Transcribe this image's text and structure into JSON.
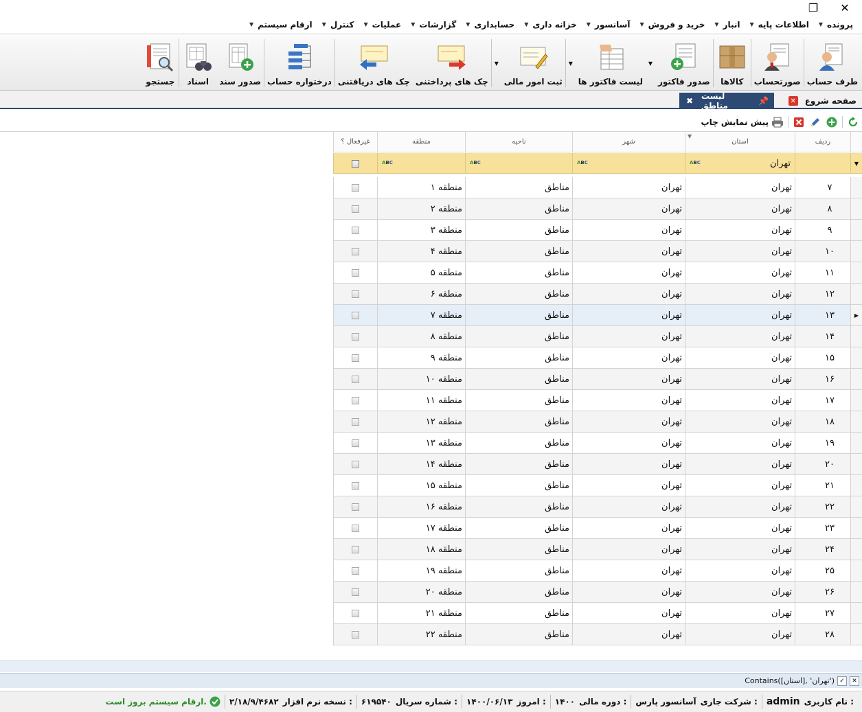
{
  "window": {
    "restore_glyph": "❐",
    "close_glyph": "✕"
  },
  "menu": [
    {
      "label": "پرونده"
    },
    {
      "label": "اطلاعات پایه"
    },
    {
      "label": "انبار"
    },
    {
      "label": "خرید و فروش"
    },
    {
      "label": "آسانسور"
    },
    {
      "label": "خزانه داری"
    },
    {
      "label": "حسابداری"
    },
    {
      "label": "گزارشات"
    },
    {
      "label": "عملیات"
    },
    {
      "label": "کنترل"
    },
    {
      "label": "ارقام سیستم"
    }
  ],
  "toolbar": {
    "party": "طرف حساب",
    "statement": "صورتحساب",
    "goods": "کالاها",
    "issue_invoice": "صدور فاکتور",
    "invoice_list": "لیست فاکتور ها",
    "financial": "ثبت امور مالی",
    "cheques_paid": "چک های پرداختنی",
    "cheques_received": "چک های دریافتنی",
    "account_tree": "درختواره حساب",
    "issue_doc": "صدور سند",
    "docs": "اسناد",
    "search": "جستجو"
  },
  "tabs": {
    "start": "صفحه شروع",
    "regions": "لیست مناطق"
  },
  "grid_tools": {
    "print_preview": "پیش نمایش چاپ"
  },
  "columns": {
    "row": "ردیف",
    "province": "استان",
    "city": "شهر",
    "district": "ناحیه",
    "region": "منطقه",
    "inactive": "غیرفعال ؟"
  },
  "filter": {
    "province": "تهران"
  },
  "rows": [
    {
      "n": "۷",
      "province": "تهران",
      "city": "تهران",
      "district": "مناطق",
      "region": "منطقه ۱"
    },
    {
      "n": "۸",
      "province": "تهران",
      "city": "تهران",
      "district": "مناطق",
      "region": "منطقه ۲"
    },
    {
      "n": "۹",
      "province": "تهران",
      "city": "تهران",
      "district": "مناطق",
      "region": "منطقه ۳"
    },
    {
      "n": "۱۰",
      "province": "تهران",
      "city": "تهران",
      "district": "مناطق",
      "region": "منطقه ۴"
    },
    {
      "n": "۱۱",
      "province": "تهران",
      "city": "تهران",
      "district": "مناطق",
      "region": "منطقه ۵"
    },
    {
      "n": "۱۲",
      "province": "تهران",
      "city": "تهران",
      "district": "مناطق",
      "region": "منطقه ۶"
    },
    {
      "n": "۱۳",
      "province": "تهران",
      "city": "تهران",
      "district": "مناطق",
      "region": "منطقه ۷"
    },
    {
      "n": "۱۴",
      "province": "تهران",
      "city": "تهران",
      "district": "مناطق",
      "region": "منطقه ۸"
    },
    {
      "n": "۱۵",
      "province": "تهران",
      "city": "تهران",
      "district": "مناطق",
      "region": "منطقه ۹"
    },
    {
      "n": "۱۶",
      "province": "تهران",
      "city": "تهران",
      "district": "مناطق",
      "region": "منطقه ۱۰"
    },
    {
      "n": "۱۷",
      "province": "تهران",
      "city": "تهران",
      "district": "مناطق",
      "region": "منطقه ۱۱"
    },
    {
      "n": "۱۸",
      "province": "تهران",
      "city": "تهران",
      "district": "مناطق",
      "region": "منطقه ۱۲"
    },
    {
      "n": "۱۹",
      "province": "تهران",
      "city": "تهران",
      "district": "مناطق",
      "region": "منطقه ۱۳"
    },
    {
      "n": "۲۰",
      "province": "تهران",
      "city": "تهران",
      "district": "مناطق",
      "region": "منطقه ۱۴"
    },
    {
      "n": "۲۱",
      "province": "تهران",
      "city": "تهران",
      "district": "مناطق",
      "region": "منطقه ۱۵"
    },
    {
      "n": "۲۲",
      "province": "تهران",
      "city": "تهران",
      "district": "مناطق",
      "region": "منطقه ۱۶"
    },
    {
      "n": "۲۳",
      "province": "تهران",
      "city": "تهران",
      "district": "مناطق",
      "region": "منطقه ۱۷"
    },
    {
      "n": "۲۴",
      "province": "تهران",
      "city": "تهران",
      "district": "مناطق",
      "region": "منطقه ۱۸"
    },
    {
      "n": "۲۵",
      "province": "تهران",
      "city": "تهران",
      "district": "مناطق",
      "region": "منطقه ۱۹"
    },
    {
      "n": "۲۶",
      "province": "تهران",
      "city": "تهران",
      "district": "مناطق",
      "region": "منطقه ۲۰"
    },
    {
      "n": "۲۷",
      "province": "تهران",
      "city": "تهران",
      "district": "مناطق",
      "region": "منطقه ۲۱"
    },
    {
      "n": "۲۸",
      "province": "تهران",
      "city": "تهران",
      "district": "مناطق",
      "region": "منطقه ۲۲"
    }
  ],
  "selected_row": "۱۳",
  "filter_expression": "Contains([استان], 'تهران')",
  "status": {
    "user_label": "نام کاربری :",
    "user": "admin",
    "company_label": "شرکت جاری :",
    "company": "آسانسور پارس",
    "fiscal_label": "دوره مالی :",
    "fiscal": "۱۴۰۰",
    "today_label": "امروز :",
    "today": "۱۴۰۰/۰۶/۱۳",
    "serial_label": "شماره سریال :",
    "serial": "۶۱۹۵۴۰",
    "version_label": "نسخه نرم افزار :",
    "version": "۲/۱۸/۹/۴۶۸۲",
    "uptodate": "ارقام سیستم بروز است."
  },
  "colors": {
    "accent": "#2c4a73",
    "filter_row": "#f8e19a",
    "ok_green": "#2e8b2e",
    "close_red": "#d9372c"
  }
}
